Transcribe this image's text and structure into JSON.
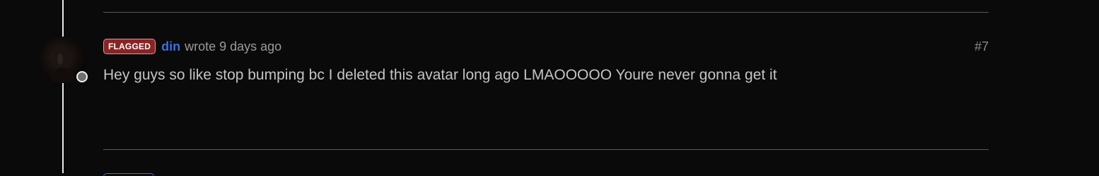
{
  "post": {
    "flag_label": "FLAGGED",
    "author": "din",
    "meta": "wrote 9 days ago",
    "number": "#7",
    "body": "Hey guys so like stop bumping bc I deleted this avatar long ago LMAOOOOO Youre never gonna get it"
  },
  "colors": {
    "flag_bg": "#8a2424",
    "author_link": "#3b6fe0",
    "background": "#0a0a0a"
  },
  "icons": {
    "avatar": "user-avatar",
    "status": "status-dot"
  }
}
